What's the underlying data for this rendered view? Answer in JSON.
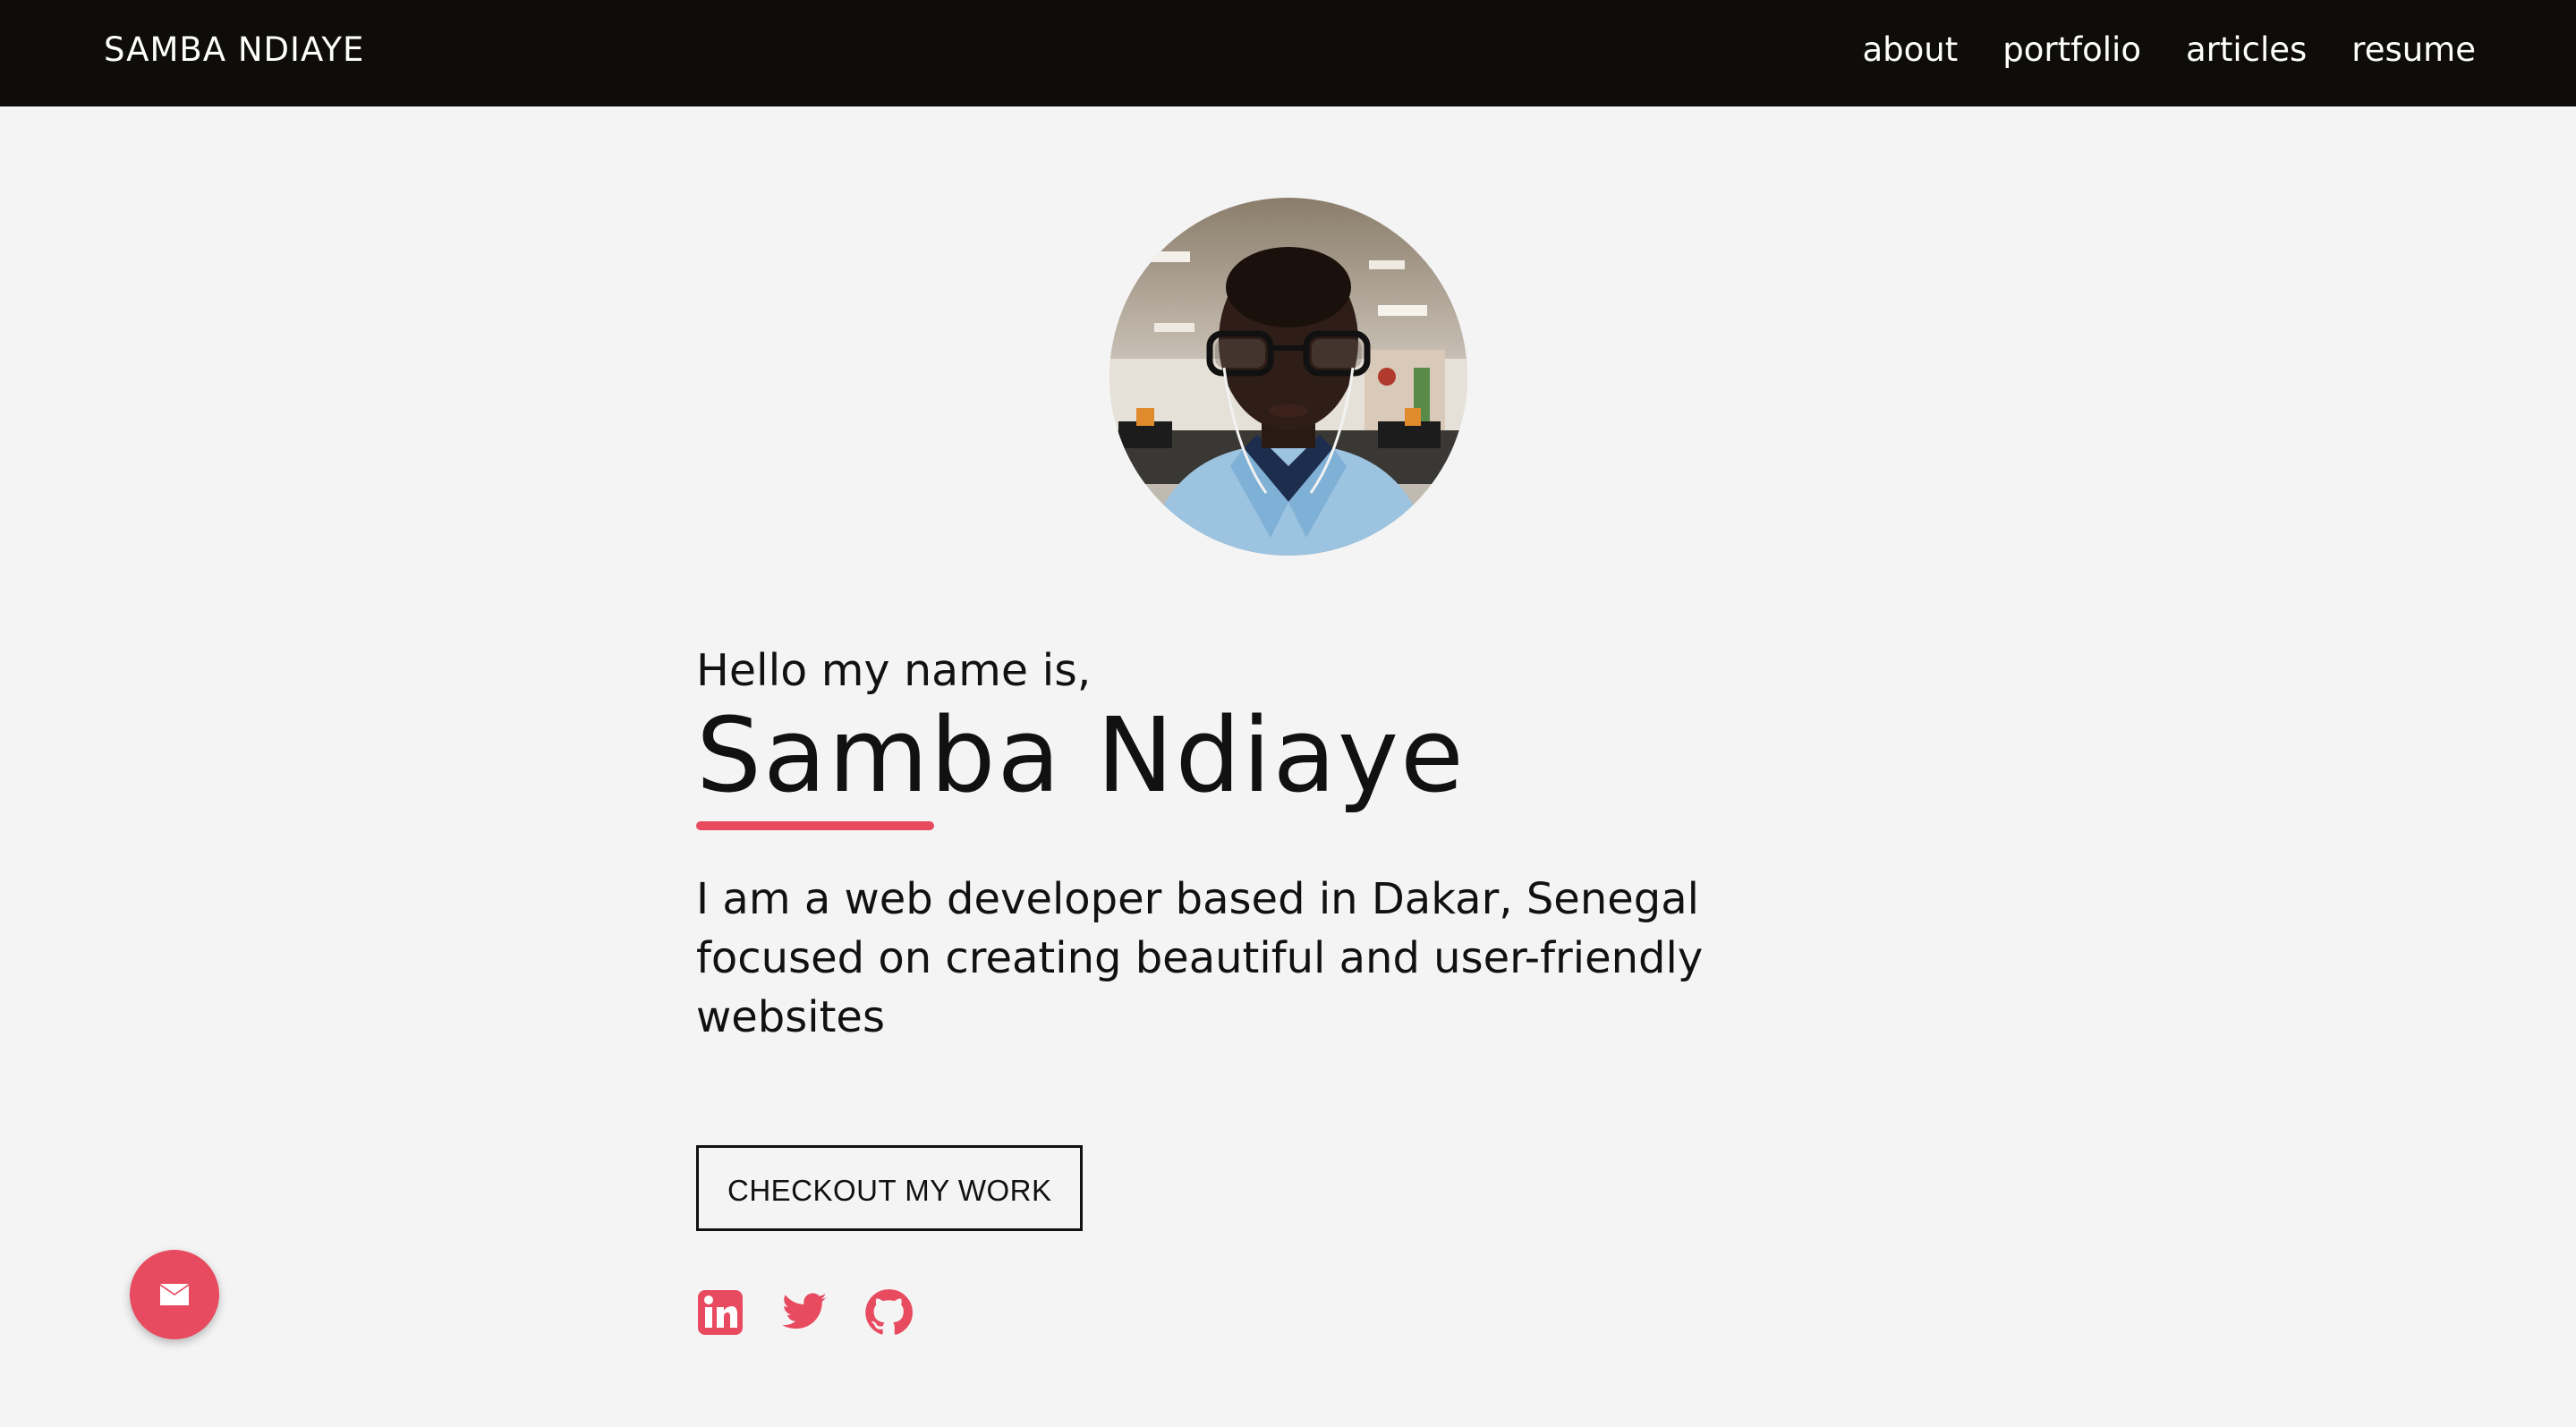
{
  "nav": {
    "brand": "SAMBA NDIAYE",
    "links": [
      {
        "label": "about"
      },
      {
        "label": "portfolio"
      },
      {
        "label": "articles"
      },
      {
        "label": "resume"
      }
    ]
  },
  "hero": {
    "greeting": "Hello my name is,",
    "name": "Samba Ndiaye",
    "bio": "I am a web developer based in Dakar, Senegal focused on creating beautiful and user-friendly websites",
    "cta_label": "CHECKOUT MY WORK"
  },
  "social": [
    {
      "icon": "linkedin-icon"
    },
    {
      "icon": "twitter-icon"
    },
    {
      "icon": "github-icon"
    }
  ],
  "fab": {
    "icon": "mail-icon"
  },
  "colors": {
    "accent": "#e84a5f",
    "navbar": "#0f0d09",
    "background": "#f4f4f4"
  }
}
